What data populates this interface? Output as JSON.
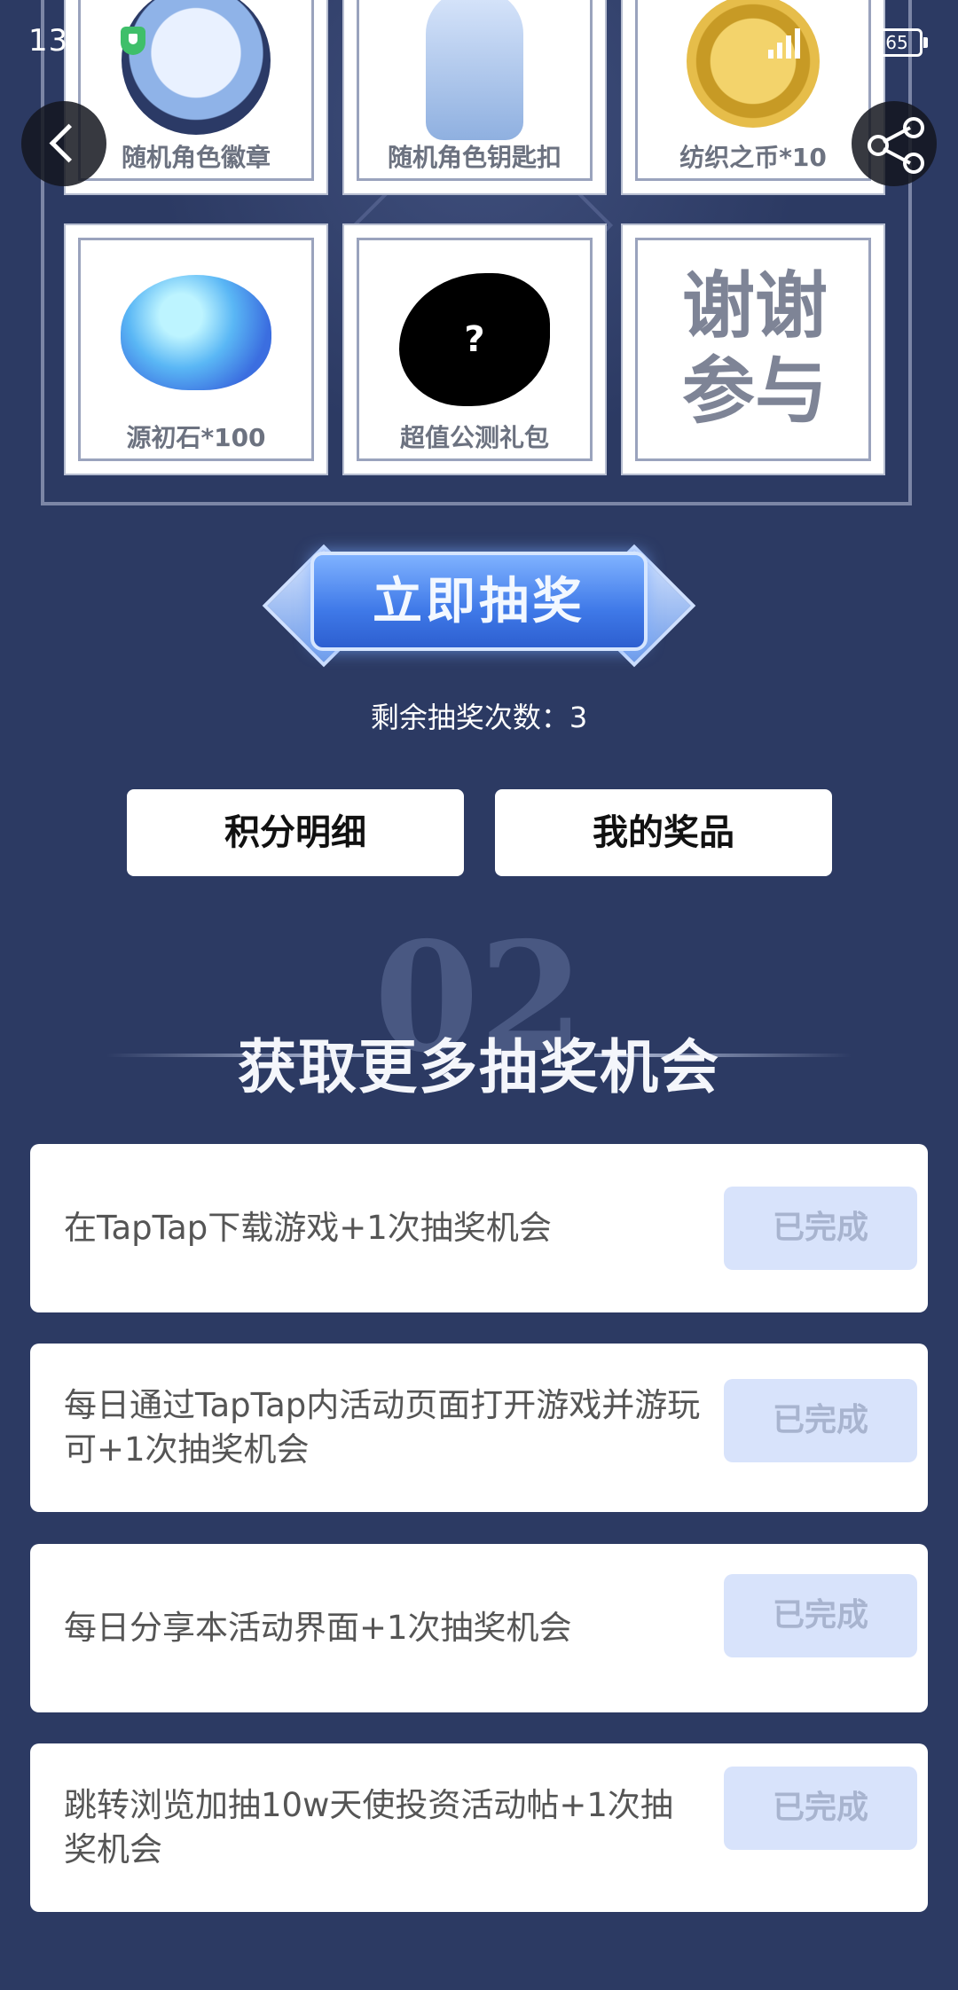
{
  "status_bar": {
    "time": "13:30",
    "battery": "65"
  },
  "prizes": [
    {
      "label": "随机角色徽章"
    },
    {
      "label": "随机角色钥匙扣"
    },
    {
      "label": "纺织之币*10"
    },
    {
      "label": "源初石*100"
    },
    {
      "label": "超值公测礼包",
      "art_text": "?"
    },
    {
      "label": "",
      "art_text": "谢谢参与"
    }
  ],
  "draw_button": {
    "label": "立即抽奖"
  },
  "remaining": {
    "text": "剩余抽奖次数：3"
  },
  "buttons": {
    "points_detail": "积分明细",
    "my_prizes": "我的奖品"
  },
  "section": {
    "number": "02",
    "title": "获取更多抽奖机会"
  },
  "tasks": [
    {
      "text": "在TapTap下载游戏+1次抽奖机会",
      "status": "已完成"
    },
    {
      "text": "每日通过TapTap内活动页面打开游戏并游玩可+1次抽奖机会",
      "status": "已完成"
    },
    {
      "text": "每日分享本活动界面+1次抽奖机会",
      "status": "已完成"
    },
    {
      "text": "跳转浏览加抽10w天使投资活动帖+1次抽奖机会",
      "status": "已完成"
    }
  ]
}
